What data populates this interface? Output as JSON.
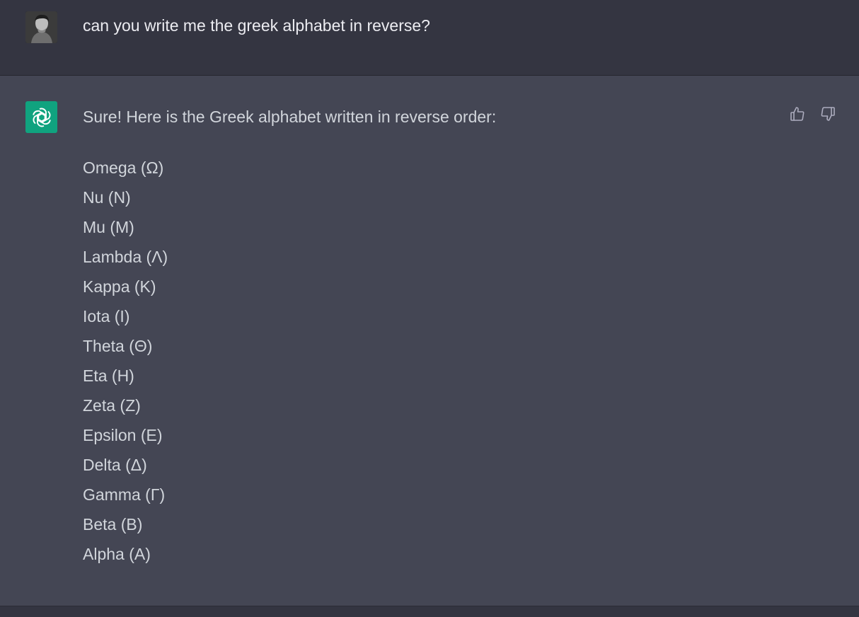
{
  "user_message": {
    "text": "can you write me the greek alphabet in reverse?",
    "avatar_icon": "user-photo-avatar"
  },
  "assistant_message": {
    "avatar_icon": "openai-logo-icon",
    "intro": "Sure! Here is the Greek alphabet written in reverse order:",
    "letters": [
      "Omega (Ω)",
      "Nu (N)",
      "Mu (M)",
      "Lambda (Λ)",
      "Kappa (K)",
      "Iota (I)",
      "Theta (Θ)",
      "Eta (H)",
      "Zeta (Z)",
      "Epsilon (E)",
      "Delta (Δ)",
      "Gamma (Γ)",
      "Beta (B)",
      "Alpha (A)"
    ],
    "feedback": {
      "thumbs_up_icon": "thumbs-up-icon",
      "thumbs_down_icon": "thumbs-down-icon"
    }
  },
  "colors": {
    "user_bg": "#343541",
    "assistant_bg": "#444654",
    "bot_avatar_bg": "#10a37f",
    "text": "#ececf1"
  }
}
